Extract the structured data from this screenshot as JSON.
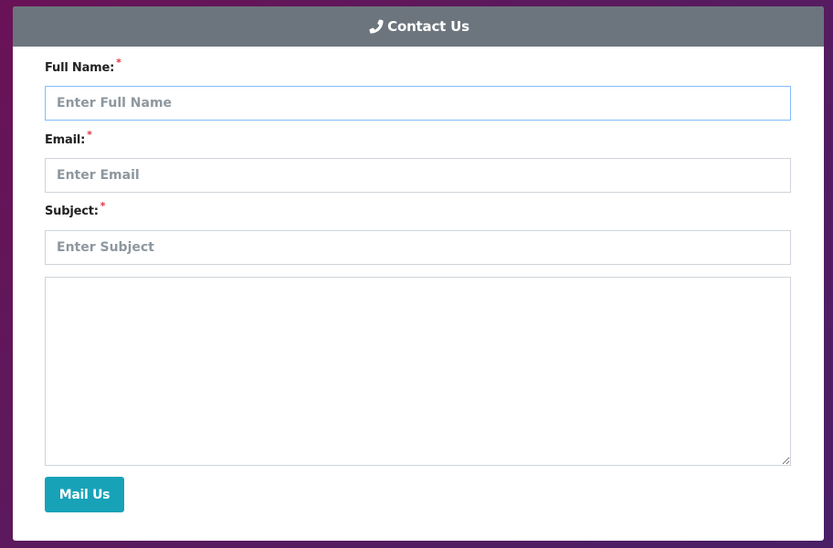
{
  "header": {
    "title": "Contact Us",
    "icon": "phone-icon"
  },
  "form": {
    "full_name": {
      "label": "Full Name:",
      "required_mark": "*",
      "placeholder": "Enter Full Name",
      "value": ""
    },
    "email": {
      "label": "Email:",
      "required_mark": "*",
      "placeholder": "Enter Email",
      "value": ""
    },
    "subject": {
      "label": "Subject:",
      "required_mark": "*",
      "placeholder": "Enter Subject",
      "value": ""
    },
    "message": {
      "value": ""
    },
    "submit_label": "Mail Us"
  },
  "colors": {
    "header_bg": "#6c757d",
    "button_bg": "#17a2b8",
    "required": "#dc3545",
    "focus_border": "#80bdff"
  }
}
